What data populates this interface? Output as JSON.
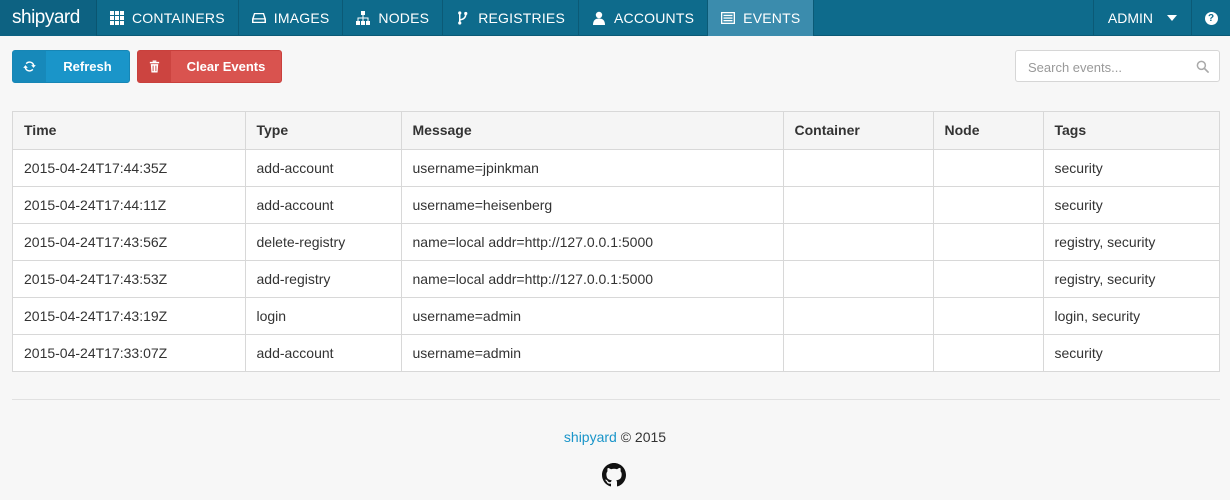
{
  "brand": "shipyard",
  "nav": {
    "items": [
      {
        "label": "CONTAINERS",
        "icon": "grid-icon"
      },
      {
        "label": "IMAGES",
        "icon": "drive-icon"
      },
      {
        "label": "NODES",
        "icon": "sitemap-icon"
      },
      {
        "label": "REGISTRIES",
        "icon": "branch-icon"
      },
      {
        "label": "ACCOUNTS",
        "icon": "user-icon"
      },
      {
        "label": "EVENTS",
        "icon": "list-icon",
        "active": true
      }
    ],
    "user": "ADMIN",
    "help": "?"
  },
  "toolbar": {
    "refresh_label": "Refresh",
    "clear_label": "Clear Events",
    "search_placeholder": "Search events..."
  },
  "table": {
    "headers": [
      "Time",
      "Type",
      "Message",
      "Container",
      "Node",
      "Tags"
    ],
    "rows": [
      [
        "2015-04-24T17:44:35Z",
        "add-account",
        "username=jpinkman",
        "",
        "",
        "security"
      ],
      [
        "2015-04-24T17:44:11Z",
        "add-account",
        "username=heisenberg",
        "",
        "",
        "security"
      ],
      [
        "2015-04-24T17:43:56Z",
        "delete-registry",
        "name=local addr=http://127.0.0.1:5000",
        "",
        "",
        "registry, security"
      ],
      [
        "2015-04-24T17:43:53Z",
        "add-registry",
        "name=local addr=http://127.0.0.1:5000",
        "",
        "",
        "registry, security"
      ],
      [
        "2015-04-24T17:43:19Z",
        "login",
        "username=admin",
        "",
        "",
        "login, security"
      ],
      [
        "2015-04-24T17:33:07Z",
        "add-account",
        "username=admin",
        "",
        "",
        "security"
      ]
    ]
  },
  "footer": {
    "link": "shipyard",
    "copyright": " © 2015"
  },
  "colors": {
    "navbar": "#0e6b8c",
    "nav_active": "#3b8cad",
    "primary": "#1a95c9",
    "danger": "#d9534f"
  }
}
